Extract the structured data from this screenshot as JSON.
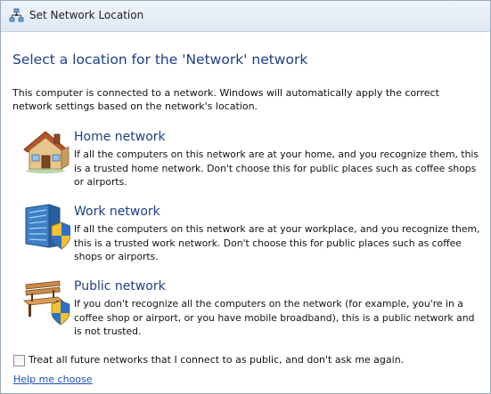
{
  "window": {
    "title": "Set Network Location",
    "title_icon": "network-location-icon"
  },
  "main": {
    "heading": "Select a location for the 'Network' network",
    "intro": "This computer is connected to a network. Windows will automatically apply the correct network settings based on the network's location."
  },
  "options": [
    {
      "title": "Home network",
      "description": "If all the computers on this network are at your home, and you recognize them, this is a trusted home network.  Don't choose this for public places such as coffee shops or airports.",
      "icon": "house-icon"
    },
    {
      "title": "Work network",
      "description": "If all the computers on this network are at your workplace, and you recognize them, this is a trusted work network.  Don't choose this for public places such as coffee shops or airports.",
      "icon": "office-building-shield-icon"
    },
    {
      "title": "Public network",
      "description": "If you don't recognize all the computers on the network (for example, you're in a coffee shop or airport, or you have mobile broadband), this is a public network and is not trusted.",
      "icon": "park-bench-shield-icon"
    }
  ],
  "footer": {
    "checkbox_label": "Treat all future networks that I connect to as public, and don't ask me again.",
    "checkbox_checked": false,
    "help_link": "Help me choose"
  },
  "colors": {
    "heading": "#1d3f86",
    "link": "#1d50b4"
  }
}
